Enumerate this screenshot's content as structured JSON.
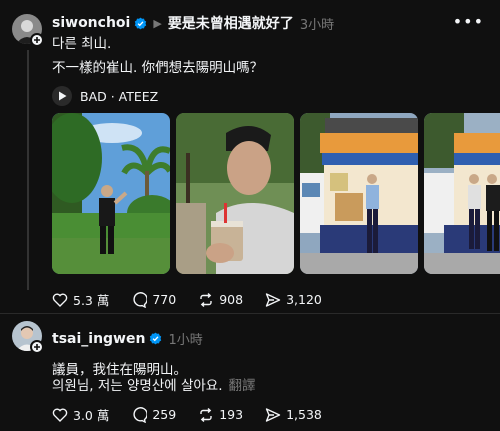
{
  "post1": {
    "username": "siwonchoi",
    "thread_title": "要是未曾相遇就好了",
    "time": "3小時",
    "line1": "다른 최山.",
    "line2": "不一樣的崔山. 你們想去陽明山嗎？",
    "music": "BAD · ATEEZ",
    "likes": "5.3 萬",
    "comments": "770",
    "reposts": "908",
    "shares": "3,120"
  },
  "post2": {
    "username": "tsai_ingwen",
    "time": "1小時",
    "line1": "議員，我住在陽明山。",
    "line2": "의원님, 저는 양명산에 살아요.",
    "translate": "翻譯",
    "likes": "3.0 萬",
    "comments": "259",
    "reposts": "193",
    "shares": "1,538"
  },
  "colors": {
    "background": "#101010",
    "text": "#f3f5f7",
    "muted": "#777777",
    "verified": "#0095f6"
  }
}
